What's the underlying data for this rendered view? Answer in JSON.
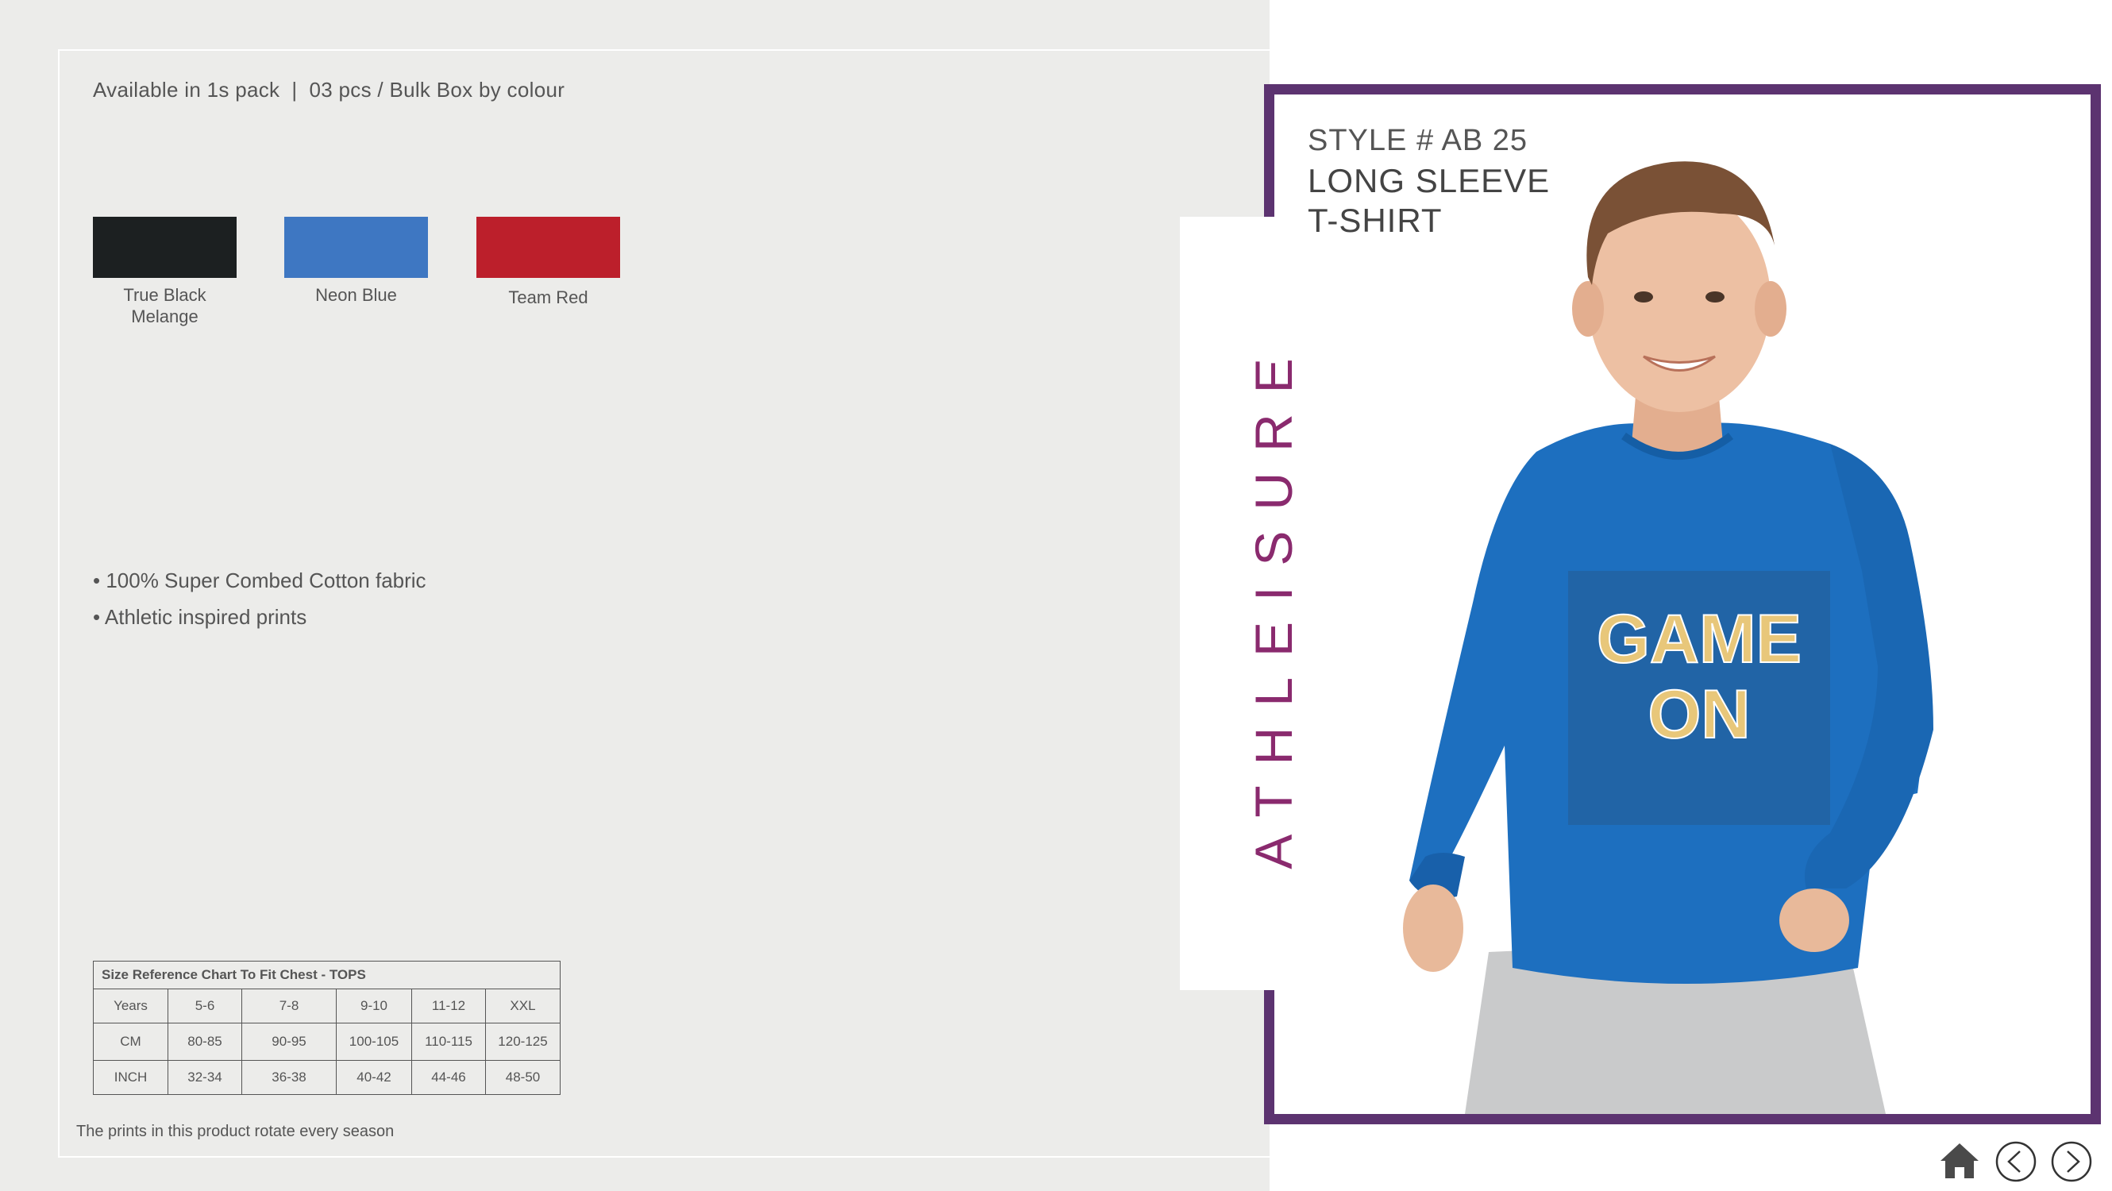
{
  "pack_info": "Available in 1s pack  |  03 pcs / Bulk Box by colour",
  "colors": [
    {
      "name_line1": "True Black",
      "name_line2": "Melange",
      "hex": "#1c2021"
    },
    {
      "name_line1": "Neon Blue",
      "name_line2": "",
      "hex": "#3e77c2"
    },
    {
      "name_line1": "Team Red",
      "name_line2": "",
      "hex": "#bc1f2b"
    }
  ],
  "features": [
    "• 100% Super Combed Cotton fabric",
    "• Athletic inspired prints"
  ],
  "size_chart": {
    "title": "Size Reference Chart To Fit Chest - TOPS",
    "rows": [
      [
        "Years",
        "5-6",
        "7-8",
        "9-10",
        "11-12",
        "XXL"
      ],
      [
        "CM",
        "80-85",
        "90-95",
        "100-105",
        "110-115",
        "120-125"
      ],
      [
        "INCH",
        "32-34",
        "36-38",
        "40-42",
        "44-46",
        "48-50"
      ]
    ]
  },
  "note": "The prints in this product rotate every season",
  "category": "ATHLEISURE",
  "style_number": "STYLE # AB 25",
  "product_name_line1": "LONG SLEEVE",
  "product_name_line2": "T-SHIRT",
  "shirt_print_line1": "GAME",
  "shirt_print_line2": "ON",
  "nav": [
    "home-icon",
    "previous-icon",
    "next-icon"
  ],
  "accent_color": "#5c3370"
}
